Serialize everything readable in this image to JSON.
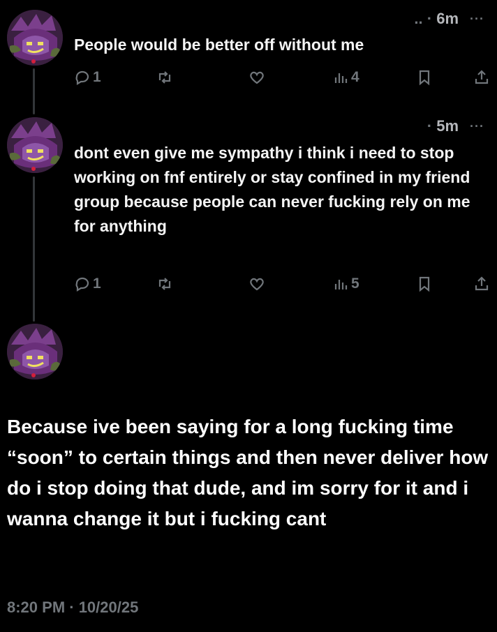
{
  "tweets": [
    {
      "time": "6m",
      "handle_dots": "..",
      "more": "···",
      "text": "People would be better off without me",
      "replies": "1",
      "retweets": "",
      "likes": "",
      "views": "4"
    },
    {
      "time": "5m",
      "handle_dots": "",
      "more": "···",
      "text": "dont even give me sympathy i think i need to stop working on fnf entirely or stay confined in my friend group because people can never fucking rely on me for anything",
      "replies": "1",
      "retweets": "",
      "likes": "",
      "views": "5"
    }
  ],
  "main_post": {
    "text": "Because ive been saying for a long fucking time “soon” to certain things and then never deliver how do i stop doing that dude, and im sorry for it and i wanna change it but i fucking cant",
    "timestamp": "8:20 PM · 10/20/25"
  },
  "colors": {
    "background": "#000000",
    "text": "#e7e9ea",
    "muted": "#71767b",
    "thread_line": "#333639"
  }
}
